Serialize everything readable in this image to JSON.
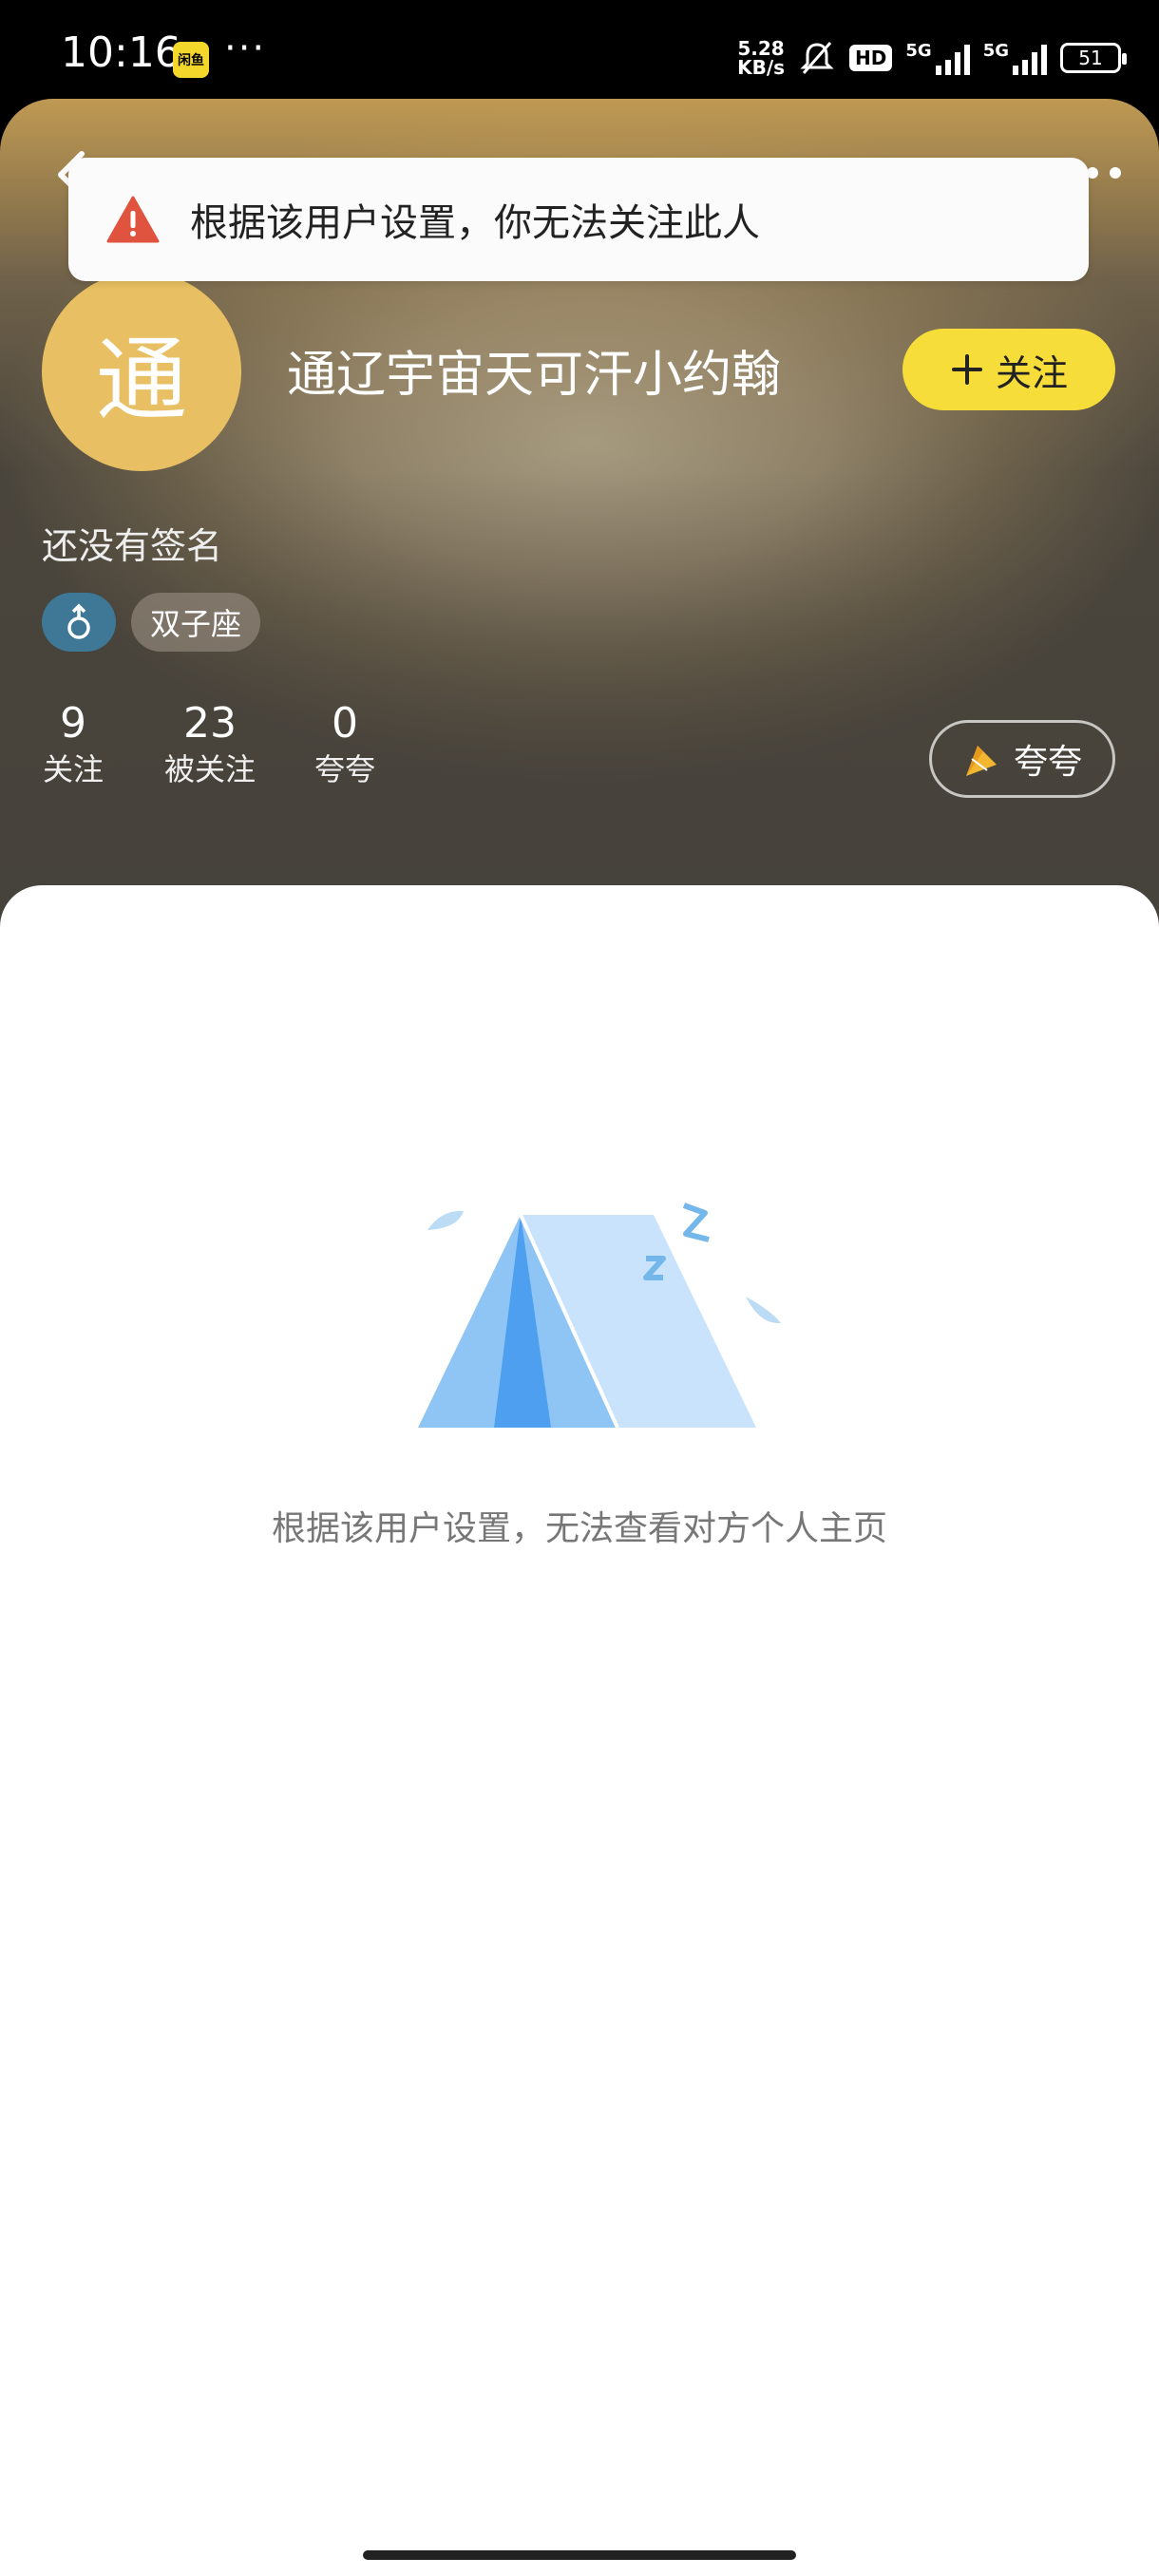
{
  "status_bar": {
    "time": "10:16",
    "app_badge": "闲鱼",
    "more_dots": "···",
    "net_speed_value": "5.28",
    "net_speed_unit": "KB/s",
    "hd_label": "HD",
    "network_1": "5G",
    "network_2": "5G",
    "battery": "51"
  },
  "toast": {
    "icon": "warning-triangle-icon",
    "message": "根据该用户设置，你无法关注此人"
  },
  "profile": {
    "avatar_char": "通",
    "avatar_color": "#e8bf62",
    "username": "通辽宇宙天可汗小约翰",
    "follow_label": "关注",
    "signature": "还没有签名",
    "gender_icon": "male-icon",
    "zodiac": "双子座",
    "stats": [
      {
        "value": "9",
        "label": "关注"
      },
      {
        "value": "23",
        "label": "被关注"
      },
      {
        "value": "0",
        "label": "夸夸"
      }
    ],
    "praise_label": "夸夸"
  },
  "empty_state": {
    "illustration": "sleeping-tent-icon",
    "message": "根据该用户设置，无法查看对方个人主页"
  },
  "colors": {
    "accent_yellow": "#f7dd3a",
    "gender_blue": "#3f7896",
    "warning_red": "#e0533e"
  }
}
